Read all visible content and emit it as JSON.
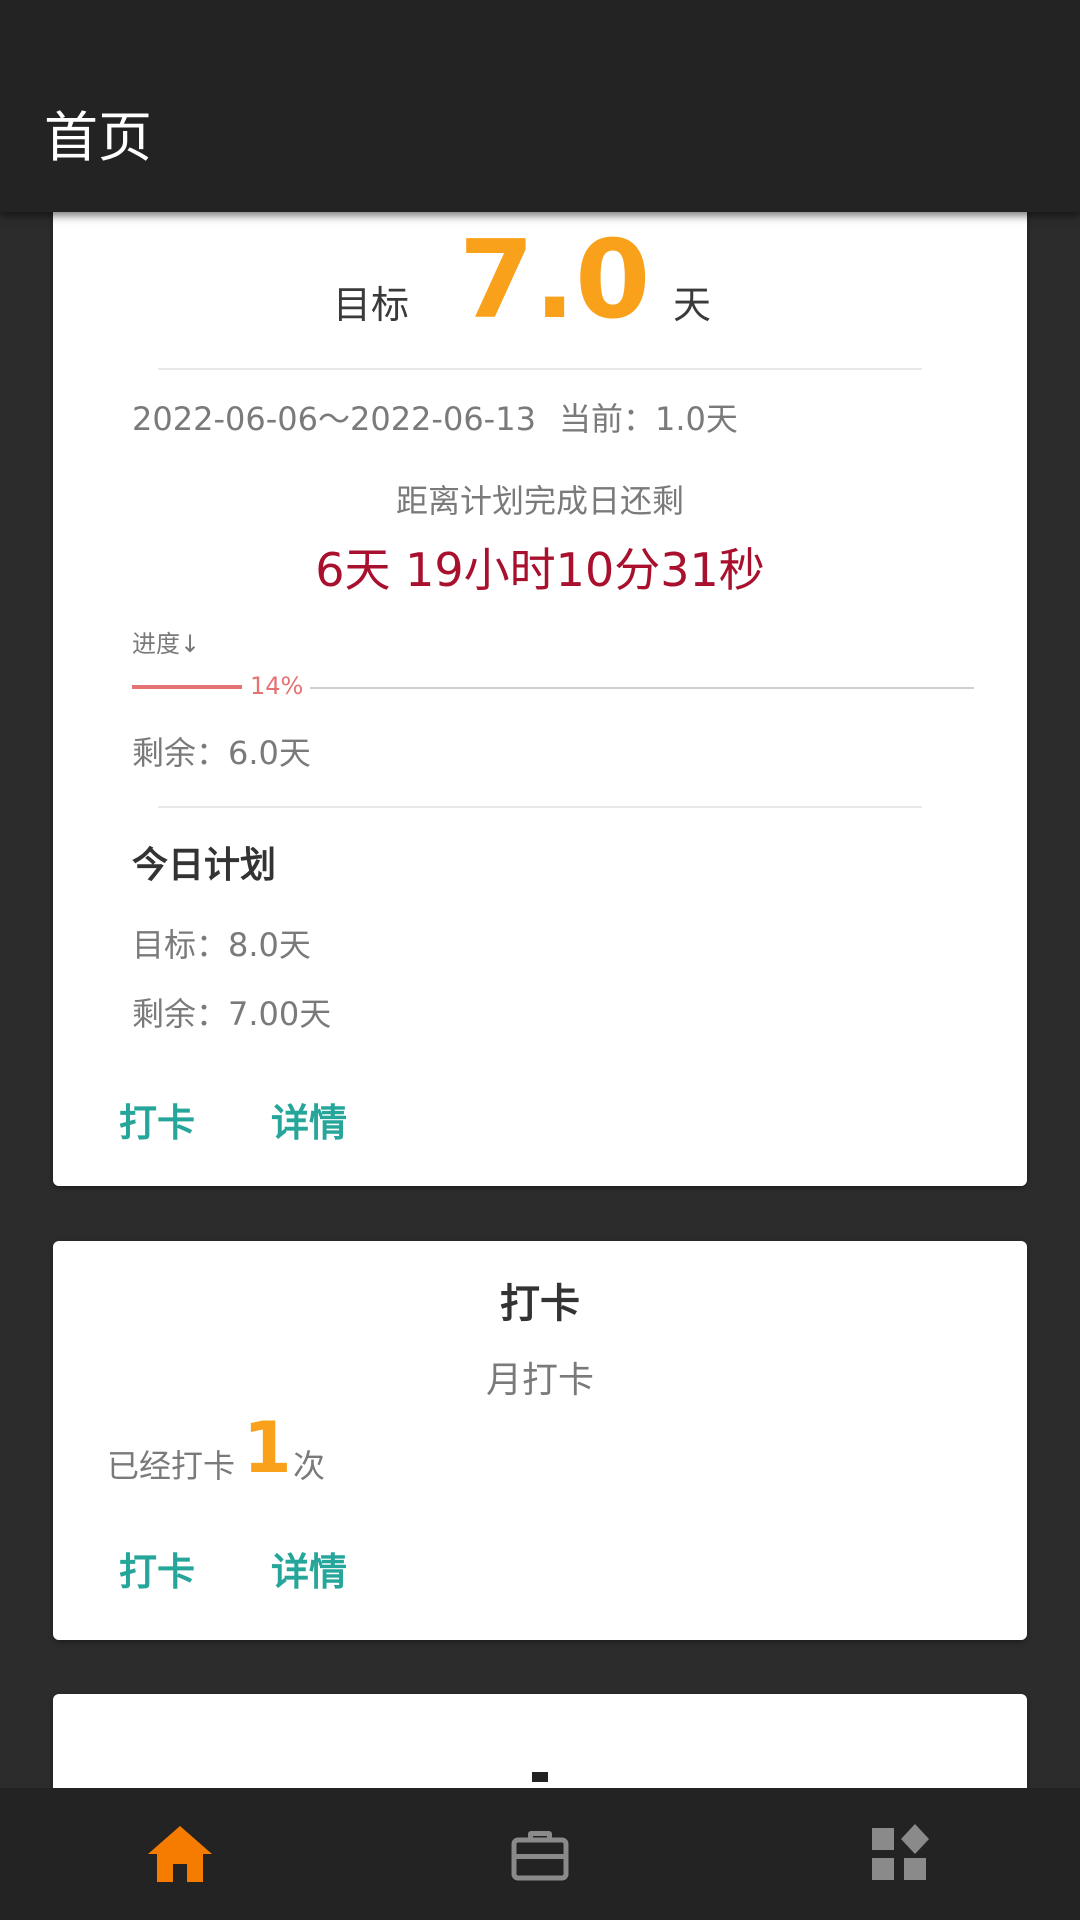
{
  "app_bar": {
    "title": "首页"
  },
  "goal_card": {
    "goal_label": "目标",
    "goal_value": "7.0",
    "goal_unit": "天",
    "date_range": "2022-06-06～2022-06-13",
    "current": "当前：1.0天",
    "countdown_label": "距离计划完成日还剩",
    "countdown_value": "6天 19小时10分31秒",
    "progress_label": "进度↓",
    "progress_percent_text": "14%",
    "progress_fraction": 0.14,
    "remaining": "剩余：6.0天",
    "today_title": "今日计划",
    "today_goal": "目标：8.0天",
    "today_remaining": "剩余：7.00天",
    "checkin_button": "打卡",
    "details_button": "详情"
  },
  "checkin_card": {
    "title": "打卡",
    "subtitle": "月打卡",
    "count_prefix": "已经打卡",
    "count_value": "1",
    "count_suffix": "次",
    "checkin_button": "打卡",
    "details_button": "详情"
  },
  "bottom_nav": {
    "items": [
      {
        "icon": "home-icon",
        "active": true
      },
      {
        "icon": "briefcase-icon",
        "active": false
      },
      {
        "icon": "widgets-icon",
        "active": false
      }
    ],
    "active_color": "#f57c00",
    "inactive_color": "#8a8a8a"
  },
  "colors": {
    "accent_orange": "#f9a11b",
    "countdown_red": "#a8102e",
    "action_teal": "#26a69a",
    "progress_red": "#e57373"
  }
}
